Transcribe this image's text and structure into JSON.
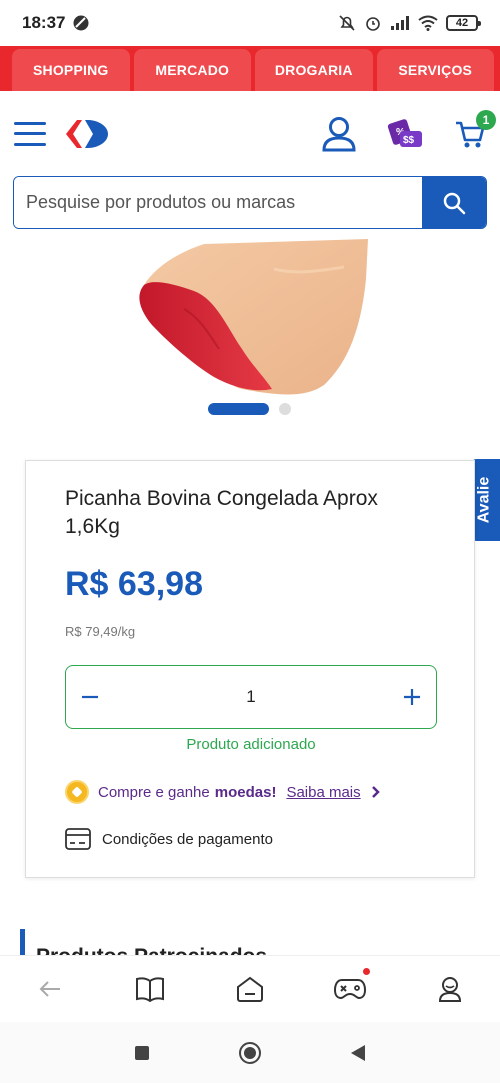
{
  "status_bar": {
    "time": "18:37",
    "battery": "42"
  },
  "top_tabs": [
    "SHOPPING",
    "MERCADO",
    "DROGARIA",
    "SERVIÇOS"
  ],
  "header": {
    "cart_count": "1"
  },
  "search": {
    "placeholder": "Pesquise por produtos ou marcas"
  },
  "side_tab": {
    "label": "Avalie"
  },
  "product": {
    "title": "Picanha Bovina Congelada Aprox 1,6Kg",
    "price": "R$ 63,98",
    "unit_price": "R$ 79,49/kg",
    "quantity": "1",
    "added_message": "Produto adicionado",
    "coins_text": "Compre e ganhe",
    "coins_bold": "moedas!",
    "coins_link": "Saiba mais",
    "payment_label": "Condições de pagamento"
  },
  "section": {
    "title": "Produtos Patrocinados"
  },
  "colors": {
    "brand_red": "#e8282d",
    "brand_blue": "#1a5ab8",
    "success_green": "#2da84f"
  }
}
